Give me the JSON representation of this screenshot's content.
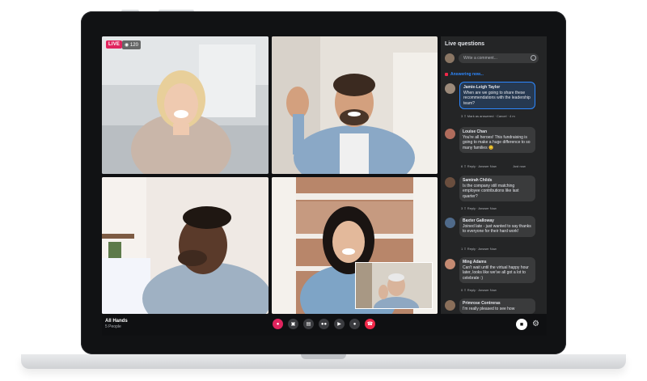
{
  "stream": {
    "live_label": "LIVE",
    "viewer_count": "120"
  },
  "meeting": {
    "title": "All Hands",
    "subtitle": "5 People"
  },
  "controls": [
    {
      "name": "live-button",
      "icon": "live"
    },
    {
      "name": "camera-switch-button",
      "icon": "camera-switch"
    },
    {
      "name": "share-screen-button",
      "icon": "share-screen"
    },
    {
      "name": "participants-button",
      "icon": "people"
    },
    {
      "name": "video-toggle-button",
      "icon": "video"
    },
    {
      "name": "mic-toggle-button",
      "icon": "mic"
    },
    {
      "name": "end-call-button",
      "icon": "phone-end"
    }
  ],
  "panel": {
    "title": "Live questions",
    "composer_placeholder": "Write a comment...",
    "answering_label": "Answering now...",
    "questions": [
      {
        "name": "Jamie-Leigh Taylor",
        "text": "When are we going to share these recommendations with the leadership team?",
        "meta": "3 ⇧  Mark as answered · Cancel · 4 m",
        "avatar_color": "#9c8a7a",
        "active": true
      },
      {
        "name": "Louise Chan",
        "text": "You're all heroes! This fundraising is going to make a huge difference to so many families 😊",
        "meta": "6 ⇧  Reply · Answer Now",
        "meta_right": "Just now",
        "avatar_color": "#b06c5c",
        "active": false
      },
      {
        "name": "Samirah Childs",
        "text": "Is the company still matching employee contributions like last quarter?",
        "meta": "3 ⇧  Reply · Answer Now",
        "avatar_color": "#6a4e3e",
        "active": false
      },
      {
        "name": "Baxter Galloway",
        "text": "Joined late - just wanted to say thanks to everyone for their hard work!",
        "meta": "1 ⇧  Reply · Answer Now",
        "avatar_color": "#4f6a8a",
        "active": false
      },
      {
        "name": "Ming Adams",
        "text": "Can't wait until the virtual happy hour later, looks like we've all got a lot to celebrate :)",
        "meta": "0 ⇧  Reply · Answer Now",
        "avatar_color": "#c48a72",
        "active": false
      },
      {
        "name": "Primrose Contreras",
        "text": "I'm really pleased to see how",
        "meta": "",
        "avatar_color": "#8a6f5a",
        "active": false
      }
    ]
  },
  "colors": {
    "live": "#e0245e",
    "accent": "#2d88ff",
    "panel_bg": "#242526",
    "bubble_bg": "#3a3b3c",
    "end_call": "#f02849"
  }
}
